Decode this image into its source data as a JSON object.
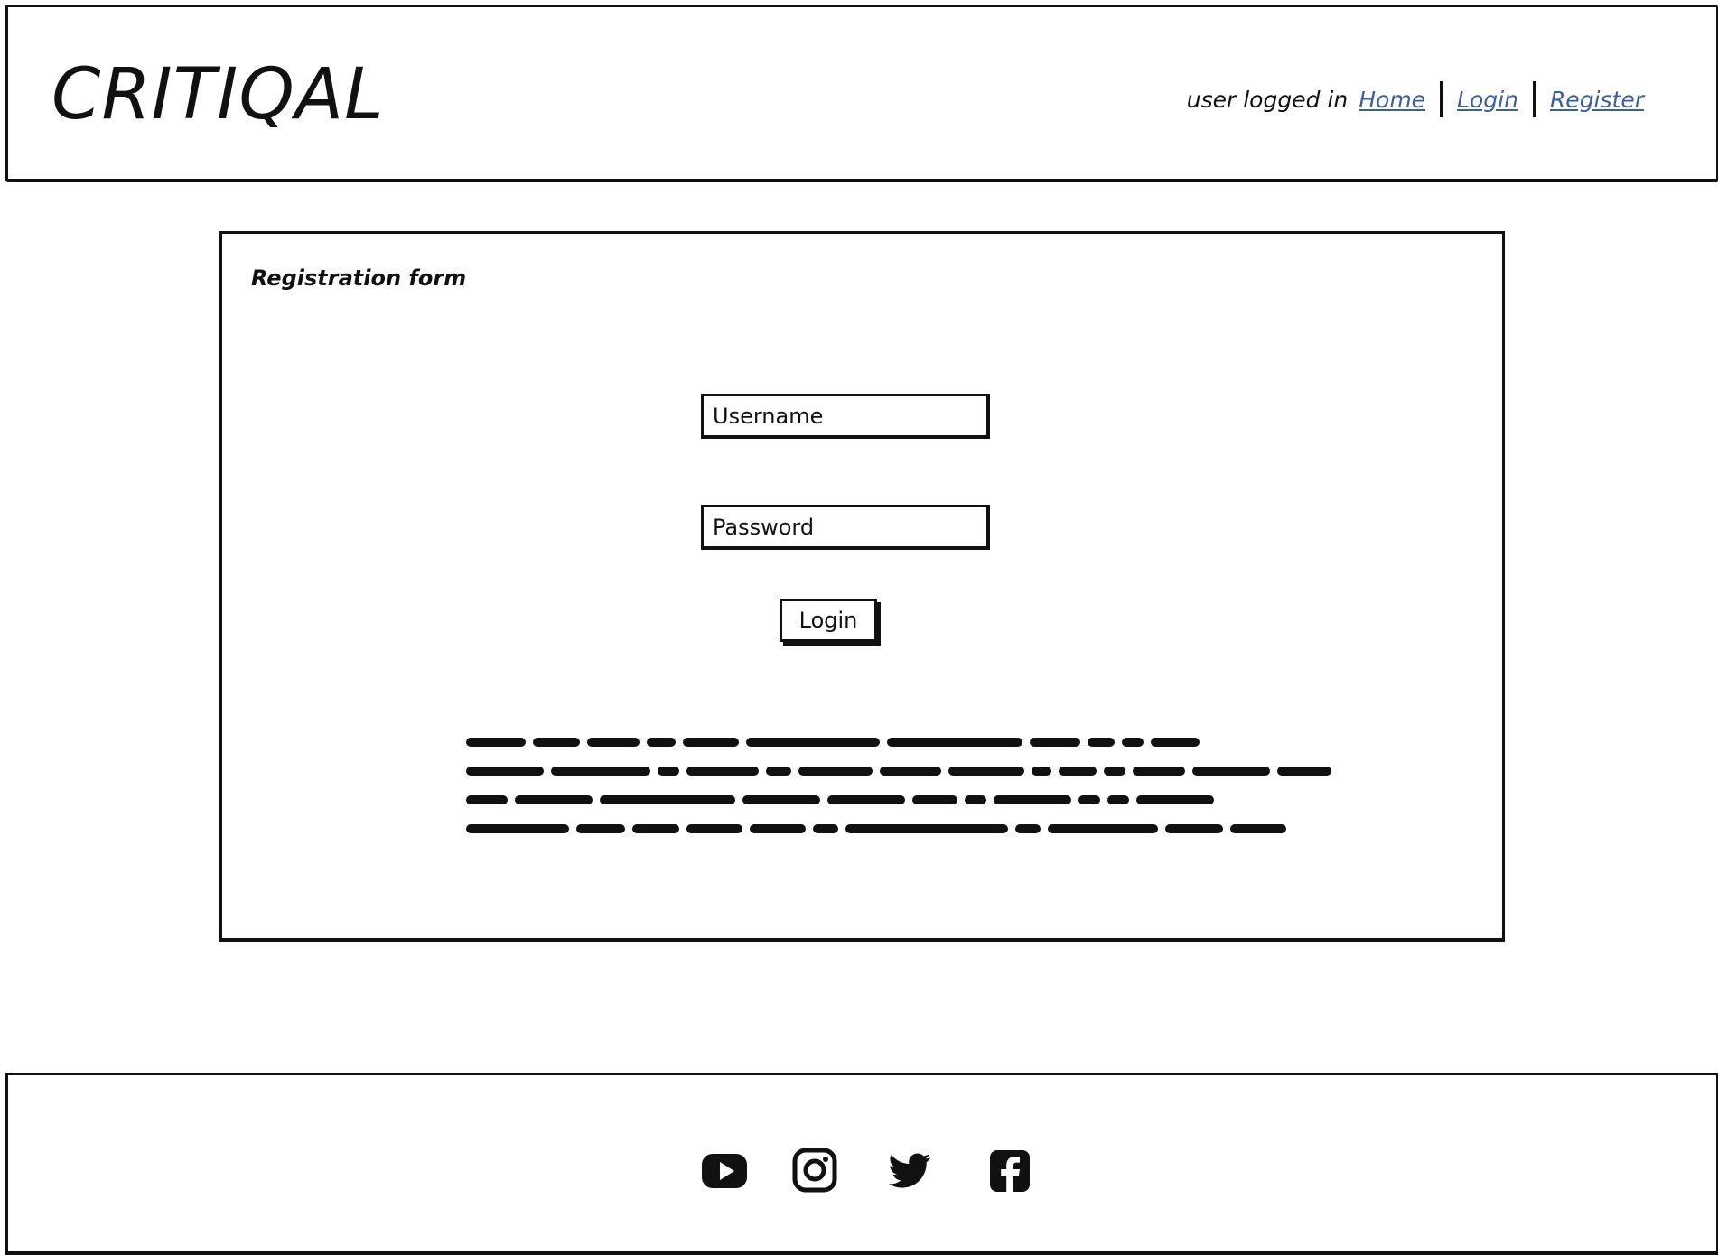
{
  "header": {
    "brand": "CRITIQAL",
    "status": "user logged in",
    "nav": [
      {
        "label": "Home"
      },
      {
        "label": "Login"
      },
      {
        "label": "Register"
      }
    ]
  },
  "form": {
    "title": "Registration form",
    "username_placeholder": "Username",
    "password_placeholder": "Password",
    "submit_label": "Login"
  },
  "footer": {
    "social": [
      {
        "icon": "youtube-icon"
      },
      {
        "icon": "instagram-icon"
      },
      {
        "icon": "twitter-icon"
      },
      {
        "icon": "facebook-icon"
      }
    ]
  },
  "colors": {
    "ink": "#111111",
    "link": "#3a5f9e",
    "background": "#ffffff"
  }
}
